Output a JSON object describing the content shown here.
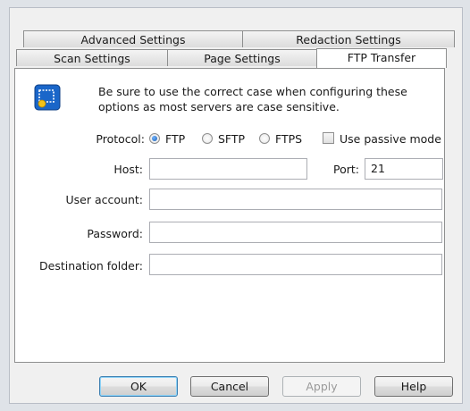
{
  "tabs_row1": [
    {
      "label": "Advanced Settings"
    },
    {
      "label": "Redaction Settings"
    }
  ],
  "tabs_row2": [
    {
      "label": "Scan Settings"
    },
    {
      "label": "Page Settings"
    },
    {
      "label": "FTP Transfer",
      "active": true
    }
  ],
  "info": {
    "text": "Be sure to use the correct case when configuring these options as most servers are case sensitive."
  },
  "protocol": {
    "label": "Protocol:",
    "options": [
      "FTP",
      "SFTP",
      "FTPS"
    ],
    "selected": "FTP",
    "passive_label": "Use passive mode",
    "passive_checked": false
  },
  "host": {
    "label": "Host:",
    "value": ""
  },
  "port": {
    "label": "Port:",
    "value": "21"
  },
  "user": {
    "label": "User account:",
    "value": ""
  },
  "password": {
    "label": "Password:",
    "value": ""
  },
  "destination": {
    "label": "Destination folder:",
    "value": ""
  },
  "buttons": {
    "ok": "OK",
    "cancel": "Cancel",
    "apply": "Apply",
    "help": "Help"
  },
  "colors": {
    "icon_blue": "#1a66c9",
    "icon_yellow": "#f2c21a"
  }
}
